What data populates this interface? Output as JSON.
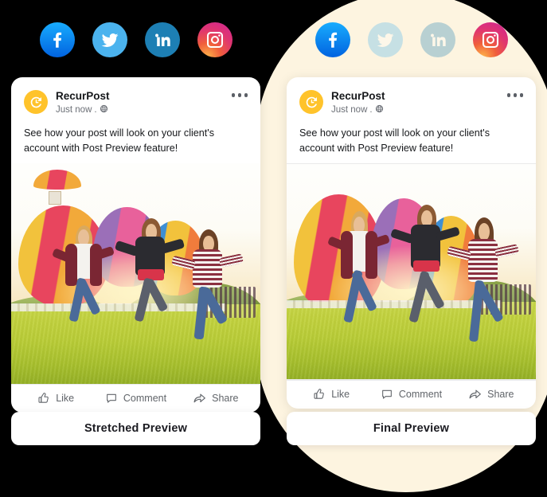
{
  "theme": {
    "background": "#000000",
    "blob_color": "#FDF4E0",
    "card_bg": "#FFFFFF",
    "brand_amber": "#FFC32B",
    "text_primary": "#16181B",
    "text_muted": "#6B6F76"
  },
  "social_bar_left": {
    "icons": [
      {
        "name": "facebook-icon",
        "label": "Facebook",
        "color": "#0163E0",
        "faded": false
      },
      {
        "name": "twitter-icon",
        "label": "Twitter",
        "color": "#4BB3EE",
        "faded": false
      },
      {
        "name": "linkedin-icon",
        "label": "LinkedIn",
        "color": "#1D7FB4",
        "faded": false
      },
      {
        "name": "instagram-icon",
        "label": "Instagram",
        "color": "#D92E7F",
        "faded": false
      }
    ]
  },
  "social_bar_right": {
    "icons": [
      {
        "name": "facebook-icon",
        "label": "Facebook",
        "color": "#0163E0",
        "faded": false
      },
      {
        "name": "twitter-icon",
        "label": "Twitter",
        "color": "#4BB3EE",
        "faded": true
      },
      {
        "name": "linkedin-icon",
        "label": "LinkedIn",
        "color": "#1D7FB4",
        "faded": true
      },
      {
        "name": "instagram-icon",
        "label": "Instagram",
        "color": "#D92E7F",
        "faded": false
      }
    ]
  },
  "cards": [
    {
      "id": "stretched",
      "author": "RecurPost",
      "timestamp": "Just now",
      "separator": ".",
      "audience_icon": "globe-icon",
      "menu_icon": "more-options-icon",
      "post_text": "See how your post will look on your client's account with Post Preview feature!",
      "image_alt": "Three young women jumping in a field with hot air balloons at sunset",
      "image_mode": "stretched",
      "actions": [
        {
          "name": "like-button",
          "label": "Like",
          "icon": "thumbs-up-icon"
        },
        {
          "name": "comment-button",
          "label": "Comment",
          "icon": "speech-bubble-icon"
        },
        {
          "name": "share-button",
          "label": "Share",
          "icon": "share-arrow-icon"
        }
      ],
      "preview_button": "Stretched Preview"
    },
    {
      "id": "final",
      "author": "RecurPost",
      "timestamp": "Just now",
      "separator": ".",
      "audience_icon": "globe-icon",
      "menu_icon": "more-options-icon",
      "post_text": "See how your post will look on your client's account with Post Preview feature!",
      "image_alt": "Three young women jumping in a field with hot air balloons at sunset",
      "image_mode": "final",
      "actions": [
        {
          "name": "like-button",
          "label": "Like",
          "icon": "thumbs-up-icon"
        },
        {
          "name": "comment-button",
          "label": "Comment",
          "icon": "speech-bubble-icon"
        },
        {
          "name": "share-button",
          "label": "Share",
          "icon": "share-arrow-icon"
        }
      ],
      "preview_button": "Final Preview"
    }
  ]
}
